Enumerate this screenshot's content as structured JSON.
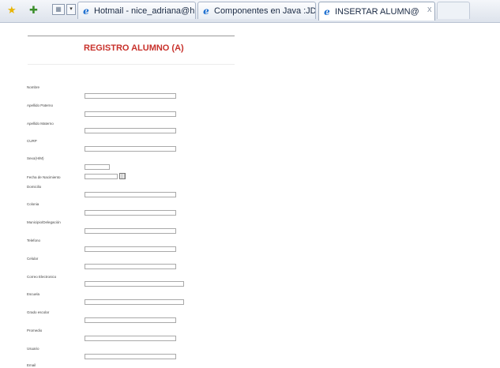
{
  "tabs": [
    {
      "label": "Hotmail - nice_adriana@h..."
    },
    {
      "label": "Componentes en Java :JDK..."
    },
    {
      "label": "INSERTAR ALUMN@"
    }
  ],
  "tab_close": "x",
  "form": {
    "title": "REGISTRO ALUMNO (A)",
    "fields": [
      {
        "label": "Nombre"
      },
      {
        "label": "Apellido Paterno"
      },
      {
        "label": "Apellido Materno"
      },
      {
        "label": "CURP"
      },
      {
        "label": "Sexo(H/M)"
      },
      {
        "label": "Fecha de Nacimiento"
      },
      {
        "label": "Domicilio"
      },
      {
        "label": "Colonia"
      },
      {
        "label": "Municipio/Delegación"
      },
      {
        "label": "Telefono"
      },
      {
        "label": "Celular"
      },
      {
        "label": "Correo Electronico"
      },
      {
        "label": "Escuela"
      },
      {
        "label": "Grado escolar"
      },
      {
        "label": "Promedio"
      },
      {
        "label": "Usuario"
      },
      {
        "label": "Email"
      }
    ]
  }
}
